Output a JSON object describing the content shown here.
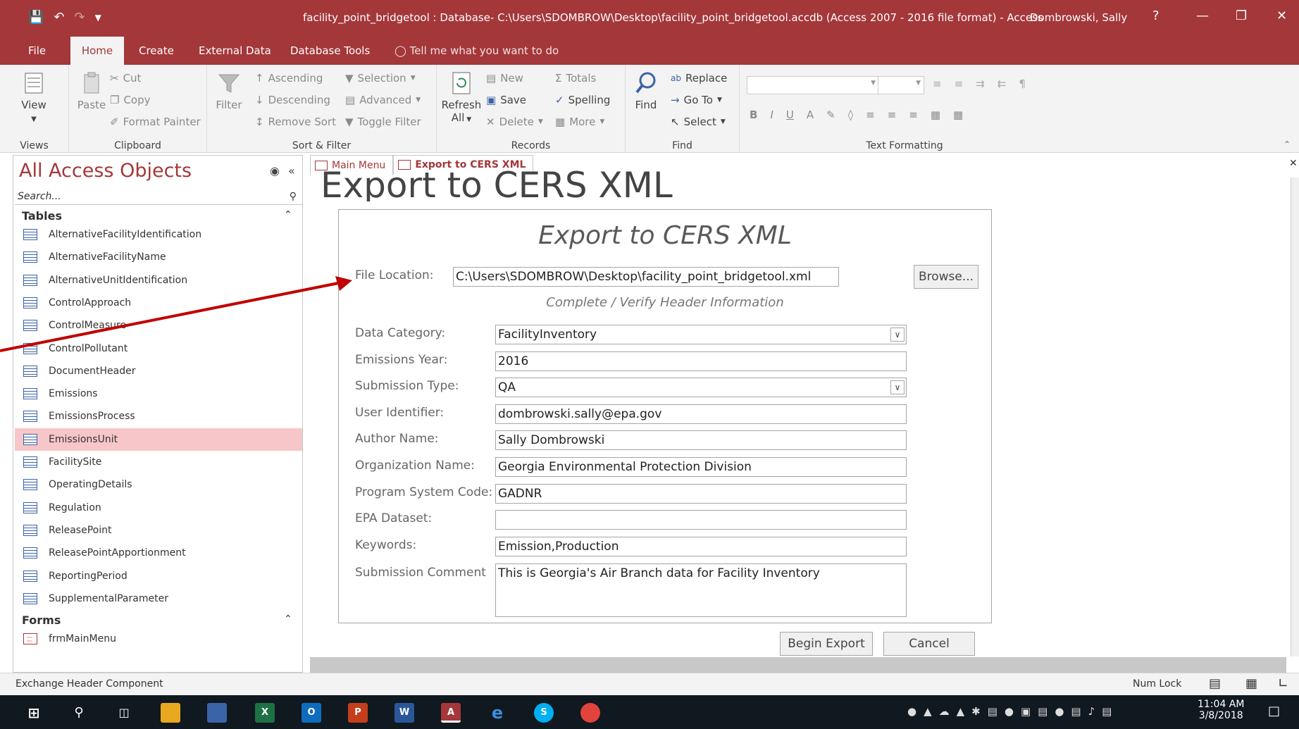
{
  "window": {
    "title": "facility_point_bridgetool : Database- C:\\Users\\SDOMBROW\\Desktop\\facility_point_bridgetool.accdb (Access 2007 - 2016 file format)  -  Access",
    "user": "Dombrowski, Sally",
    "help": "?"
  },
  "menu": {
    "tabs": [
      "File",
      "Home",
      "Create",
      "External Data",
      "Database Tools"
    ],
    "active": "Home",
    "tell_me": "Tell me what you want to do"
  },
  "ribbon": {
    "views": {
      "view": "View",
      "label": "Views"
    },
    "clipboard": {
      "paste": "Paste",
      "cut": "Cut",
      "copy": "Copy",
      "format_painter": "Format Painter",
      "label": "Clipboard"
    },
    "sort_filter": {
      "filter": "Filter",
      "ascending": "Ascending",
      "descending": "Descending",
      "remove_sort": "Remove Sort",
      "selection": "Selection",
      "advanced": "Advanced",
      "toggle_filter": "Toggle Filter",
      "label": "Sort & Filter"
    },
    "records": {
      "refresh": "Refresh",
      "refresh_sub": "All",
      "new": "New",
      "save": "Save",
      "delete": "Delete",
      "totals": "Totals",
      "spelling": "Spelling",
      "more": "More",
      "label": "Records"
    },
    "find": {
      "find": "Find",
      "replace": "Replace",
      "goto": "Go To",
      "select": "Select",
      "label": "Find"
    },
    "text_formatting": {
      "bold": "B",
      "italic": "I",
      "underline": "U",
      "label": "Text Formatting"
    }
  },
  "nav": {
    "title": "All Access Objects",
    "search_placeholder": "Search...",
    "tables_header": "Tables",
    "tables": [
      "AlternativeFacilityIdentification",
      "AlternativeFacilityName",
      "AlternativeUnitIdentification",
      "ControlApproach",
      "ControlMeasure",
      "ControlPollutant",
      "DocumentHeader",
      "Emissions",
      "EmissionsProcess",
      "EmissionsUnit",
      "FacilitySite",
      "OperatingDetails",
      "Regulation",
      "ReleasePoint",
      "ReleasePointApportionment",
      "ReportingPeriod",
      "SupplementalParameter"
    ],
    "selected_table": "EmissionsUnit",
    "forms_header": "Forms",
    "forms": [
      "frmMainMenu"
    ]
  },
  "doc_tabs": [
    "Main Menu",
    "Export to CERS XML"
  ],
  "form": {
    "heading": "Export to CERS XML",
    "title": "Export to CERS XML",
    "file_location_label": "File Location:",
    "file_location": "C:\\Users\\SDOMBROW\\Desktop\\facility_point_bridgetool.xml",
    "browse": "Browse...",
    "subheading": "Complete / Verify Header Information",
    "fields": [
      {
        "label": "Data Category:",
        "value": "FacilityInventory",
        "dropdown": true
      },
      {
        "label": "Emissions Year:",
        "value": "2016",
        "dropdown": false
      },
      {
        "label": "Submission Type:",
        "value": "QA",
        "dropdown": true
      },
      {
        "label": "User Identifier:",
        "value": "dombrowski.sally@epa.gov",
        "dropdown": false
      },
      {
        "label": "Author Name:",
        "value": "Sally Dombrowski",
        "dropdown": false
      },
      {
        "label": "Organization Name:",
        "value": "Georgia Environmental Protection Division",
        "dropdown": false
      },
      {
        "label": "Program System Code:",
        "value": "GADNR",
        "dropdown": false
      },
      {
        "label": "EPA Dataset:",
        "value": "",
        "dropdown": false
      },
      {
        "label": "Keywords:",
        "value": "Emission,Production",
        "dropdown": false
      }
    ],
    "comment_label": "Submission Comment",
    "comment": "This is Georgia's Air Branch data for Facility Inventory",
    "begin_export": "Begin Export",
    "cancel": "Cancel"
  },
  "status": {
    "left": "Exchange Header Component",
    "num_lock": "Num Lock"
  },
  "taskbar": {
    "time": "11:04 AM",
    "date": "3/8/2018"
  },
  "colors": {
    "accent": "#a4373a",
    "selected_row": "#f7c6c8",
    "arrow": "#c00000"
  }
}
